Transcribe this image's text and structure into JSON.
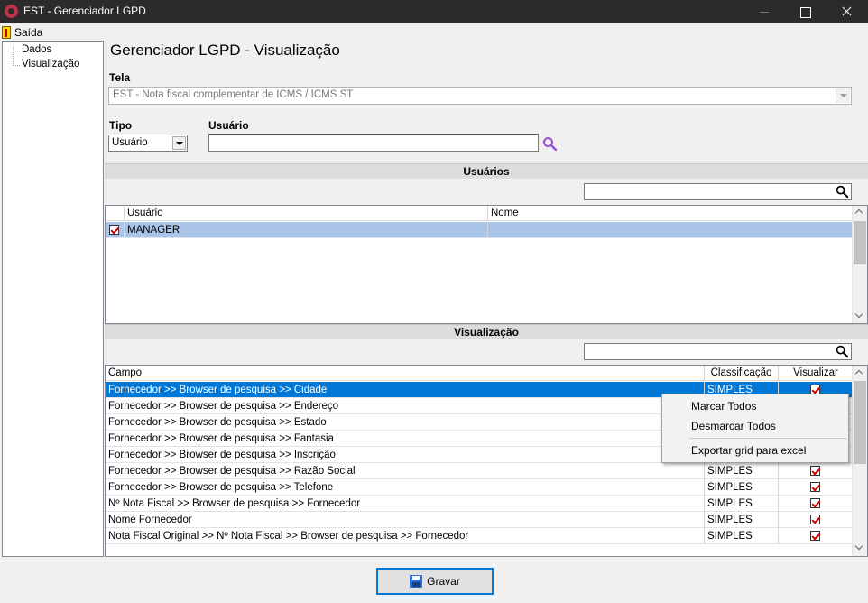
{
  "window": {
    "title": "EST - Gerenciador LGPD"
  },
  "menu": {
    "exit_label": "Saída"
  },
  "tree": {
    "items": [
      "Dados",
      "Visualização"
    ]
  },
  "page": {
    "title": "Gerenciador LGPD - Visualização"
  },
  "form": {
    "tela_label": "Tela",
    "tela_value": "EST - Nota fiscal complementar de ICMS / ICMS ST",
    "tipo_label": "Tipo",
    "tipo_value": "Usuário",
    "usuario_label": "Usuário",
    "usuario_value": ""
  },
  "users_section": {
    "title": "Usuários",
    "filter_value": "",
    "columns": [
      "Usuário",
      "Nome"
    ],
    "rows": [
      {
        "checked": true,
        "usuario": "MANAGER",
        "nome": ""
      }
    ]
  },
  "view_section": {
    "title": "Visualização",
    "filter_value": "",
    "columns": [
      "Campo",
      "Classificação",
      "Visualizar"
    ],
    "rows": [
      {
        "campo": "Fornecedor >> Browser de pesquisa >> Cidade",
        "classificacao": "SIMPLES",
        "visualizar": true
      },
      {
        "campo": "Fornecedor >> Browser de pesquisa >> Endereço",
        "classificacao": "",
        "visualizar": true
      },
      {
        "campo": "Fornecedor >> Browser de pesquisa >> Estado",
        "classificacao": "",
        "visualizar": true
      },
      {
        "campo": "Fornecedor >> Browser de pesquisa >> Fantasia",
        "classificacao": "",
        "visualizar": true
      },
      {
        "campo": "Fornecedor >> Browser de pesquisa >> Inscrição",
        "classificacao": "",
        "visualizar": true
      },
      {
        "campo": "Fornecedor >> Browser de pesquisa >> Razão Social",
        "classificacao": "SIMPLES",
        "visualizar": true
      },
      {
        "campo": "Fornecedor >> Browser de pesquisa >> Telefone",
        "classificacao": "SIMPLES",
        "visualizar": true
      },
      {
        "campo": "Nº Nota Fiscal >> Browser de pesquisa >> Fornecedor",
        "classificacao": "SIMPLES",
        "visualizar": true
      },
      {
        "campo": "Nome Fornecedor",
        "classificacao": "SIMPLES",
        "visualizar": true
      },
      {
        "campo": "Nota Fiscal Original >> Nº Nota Fiscal >> Browser de pesquisa >> Fornecedor",
        "classificacao": "SIMPLES",
        "visualizar": true
      }
    ]
  },
  "context_menu": {
    "items": [
      "Marcar Todos",
      "Desmarcar Todos",
      "Exportar grid para excel"
    ]
  },
  "footer": {
    "save_label": "Gravar"
  },
  "colors": {
    "title_bar": "#2b2b2b",
    "selection": "#0078d7",
    "check_mark": "#d00000"
  }
}
